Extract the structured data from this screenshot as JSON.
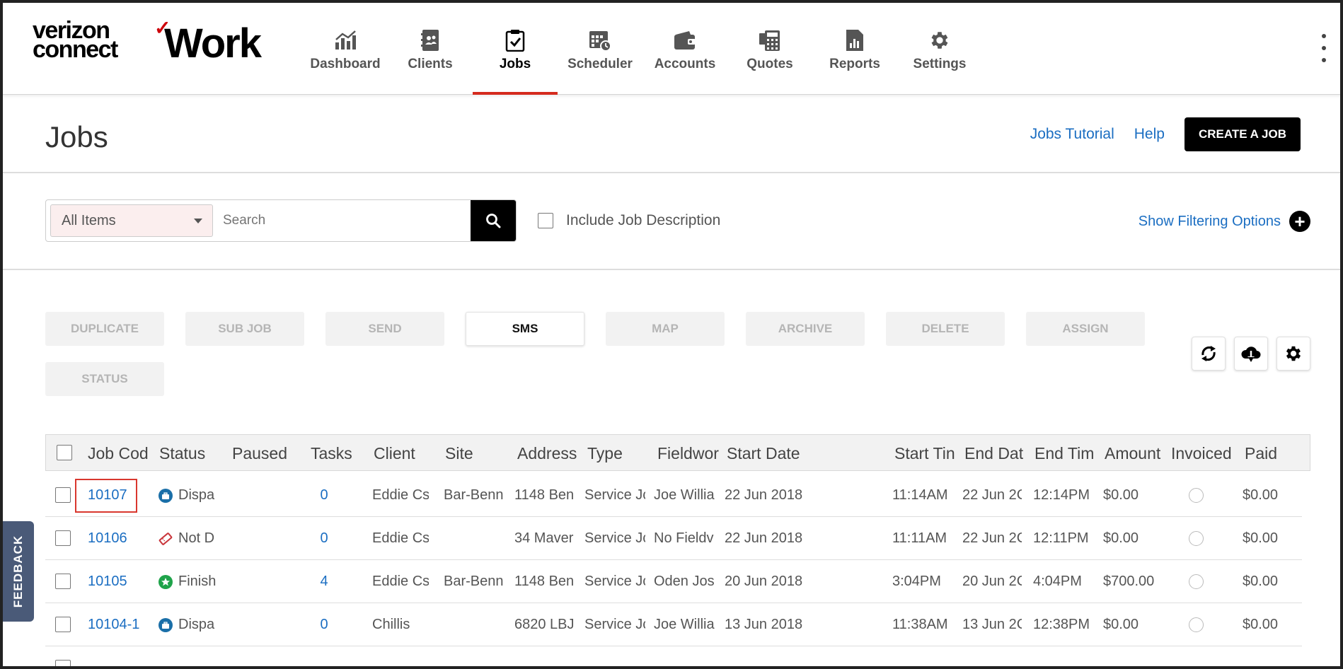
{
  "brand": {
    "logo_line1": "verizon",
    "logo_line2": "connect",
    "logo_check": "✓",
    "product": "Work"
  },
  "nav": {
    "items": [
      {
        "label": "Dashboard",
        "icon": "dashboard-chart-icon"
      },
      {
        "label": "Clients",
        "icon": "clients-book-icon"
      },
      {
        "label": "Jobs",
        "icon": "jobs-clipboard-icon",
        "active": true
      },
      {
        "label": "Scheduler",
        "icon": "scheduler-calendar-icon"
      },
      {
        "label": "Accounts",
        "icon": "accounts-wallet-icon"
      },
      {
        "label": "Quotes",
        "icon": "quotes-calculator-icon"
      },
      {
        "label": "Reports",
        "icon": "reports-document-icon"
      },
      {
        "label": "Settings",
        "icon": "settings-gear-icon"
      }
    ]
  },
  "header": {
    "title": "Jobs",
    "tutorial_link": "Jobs Tutorial",
    "help_link": "Help",
    "create_button": "CREATE A JOB"
  },
  "search": {
    "filter_value": "All Items",
    "placeholder": "Search",
    "include_desc_label": "Include Job Description",
    "show_filters_label": "Show Filtering Options"
  },
  "actions": [
    {
      "label": "DUPLICATE",
      "enabled": false
    },
    {
      "label": "SUB JOB",
      "enabled": false
    },
    {
      "label": "SEND",
      "enabled": false
    },
    {
      "label": "SMS",
      "enabled": true
    },
    {
      "label": "MAP",
      "enabled": false
    },
    {
      "label": "ARCHIVE",
      "enabled": false
    },
    {
      "label": "DELETE",
      "enabled": false
    },
    {
      "label": "ASSIGN",
      "enabled": false
    },
    {
      "label": "STATUS",
      "enabled": false
    }
  ],
  "table": {
    "columns": [
      "Job Cod",
      "Status",
      "Paused",
      "Tasks",
      "Client",
      "Site",
      "Address",
      "Type",
      "Fieldwor",
      "Start Date",
      "Start Tin",
      "End Dat",
      "End Tim",
      "Amount",
      "Invoiced",
      "Paid"
    ],
    "rows": [
      {
        "code": "10107",
        "status": "Dispa",
        "status_kind": "dispatched",
        "paused": "",
        "tasks": "0",
        "client": "Eddie Cs",
        "site": "Bar-Benn",
        "address": "1148 Ben",
        "type": "Service Jc",
        "fieldworker": "Joe Willia",
        "start_date": "22 Jun 2018",
        "start_time": "11:14AM",
        "end_date": "22 Jun 2C",
        "end_time": "12:14PM",
        "amount": "$0.00",
        "paid": "$0.00",
        "highlight": true
      },
      {
        "code": "10106",
        "status": "Not D",
        "status_kind": "not-dispatched",
        "paused": "",
        "tasks": "0",
        "client": "Eddie Cs",
        "site": "",
        "address": "34 Maver",
        "type": "Service Jc",
        "fieldworker": "No Fieldv",
        "start_date": "22 Jun 2018",
        "start_time": "11:11AM",
        "end_date": "22 Jun 2C",
        "end_time": "12:11PM",
        "amount": "$0.00",
        "paid": "$0.00"
      },
      {
        "code": "10105",
        "status": "Finish",
        "status_kind": "finished",
        "paused": "",
        "tasks": "4",
        "client": "Eddie Cs",
        "site": "Bar-Benn",
        "address": "1148 Ben",
        "type": "Service Jc",
        "fieldworker": "Oden Jos",
        "start_date": "20 Jun 2018",
        "start_time": "3:04PM",
        "end_date": "20 Jun 2C",
        "end_time": "4:04PM",
        "amount": "$700.00",
        "paid": "$0.00"
      },
      {
        "code": "10104-1",
        "status": "Dispa",
        "status_kind": "dispatched",
        "paused": "",
        "tasks": "0",
        "client": "Chillis",
        "site": "",
        "address": "6820 LBJ",
        "type": "Service Jc",
        "fieldworker": "Joe Willia",
        "start_date": "13 Jun 2018",
        "start_time": "11:38AM",
        "end_date": "13 Jun 2C",
        "end_time": "12:38PM",
        "amount": "$0.00",
        "paid": "$0.00"
      }
    ]
  },
  "feedback_label": "FEEDBACK",
  "colors": {
    "accent_red": "#d52b1e",
    "link_blue": "#1b6ec2",
    "dispatched_blue": "#1a6fa8",
    "finished_green": "#1fa34a",
    "not_dispatched_red": "#c9353b"
  }
}
